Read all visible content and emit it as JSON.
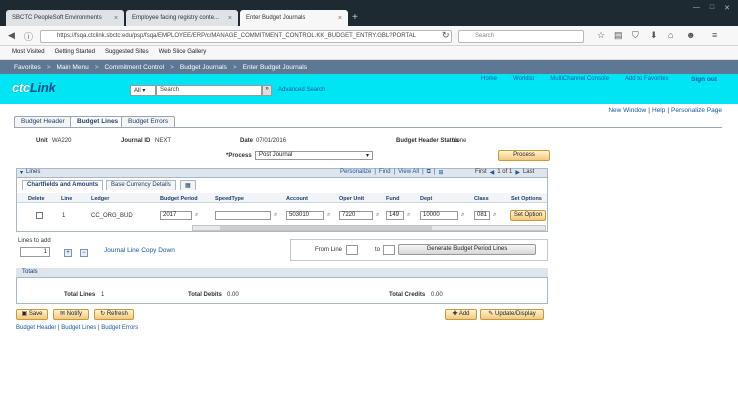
{
  "browser": {
    "tabs": [
      {
        "label": "SBCTC PeopleSoft Environments",
        "active": false
      },
      {
        "label": "Employee facing registry conte...",
        "active": false
      },
      {
        "label": "Enter Budget Journals",
        "active": true
      }
    ],
    "url": "https://fsqa.ctclink.sbctc.edu/psp/fsqa/EMPLOYEE/ERP/c/MANAGE_COMMITMENT_CONTROL.KK_BUDGET_ENTRY.GBL?PORTAL",
    "search_placeholder": "Search",
    "bookmarks": [
      "Most Visited",
      "Getting Started",
      "Suggested Sites",
      "Web Slice Gallery"
    ]
  },
  "ps_nav": {
    "items": [
      "Favorites",
      "Main Menu",
      "Commitment Control",
      "Budget Journals",
      "Enter Budget Journals"
    ],
    "separator": ">"
  },
  "banner": {
    "logo_ctc": "ctc",
    "logo_link": "Link",
    "links": [
      "Home",
      "Worklist",
      "MultiChannel Console",
      "Add to Favorites"
    ],
    "sign_out": "Sign out",
    "search_scope": "All",
    "search_value": "Search",
    "advanced_search": "Advanced Search"
  },
  "top_links": [
    "New Window",
    "Help",
    "Personalize Page"
  ],
  "page_tabs": [
    {
      "label": "Budget Header",
      "active": false
    },
    {
      "label": "Budget Lines",
      "active": true
    },
    {
      "label": "Budget Errors",
      "active": false
    }
  ],
  "header": {
    "unit_label": "Unit",
    "unit_value": "WA220",
    "journal_id_label": "Journal ID",
    "journal_id_value": "NEXT",
    "date_label": "Date",
    "date_value": "07/01/2016",
    "status_label": "Budget Header Status",
    "status_value": "None",
    "process_label": "*Process",
    "process_value": "Post Journal",
    "process_button": "Process"
  },
  "lines": {
    "title": "Lines",
    "nav": {
      "personalize": "Personalize",
      "find": "Find",
      "view_all": "View All",
      "first": "First",
      "range": "1 of 1",
      "last": "Last"
    },
    "subtabs": [
      {
        "label": "Chartfields and Amounts",
        "active": true
      },
      {
        "label": "Base Currency Details",
        "active": false
      }
    ],
    "columns": [
      "Delete",
      "Line",
      "Ledger",
      "Budget Period",
      "SpeedType",
      "Account",
      "Oper Unit",
      "Fund",
      "Dept",
      "Class",
      "Set Options"
    ],
    "rows": [
      {
        "line": "1",
        "ledger": "CC_ORG_BUD",
        "budget_period": "2017",
        "speedtype": "",
        "account": "503010",
        "oper_unit": "7220",
        "fund": "149",
        "dept": "10000",
        "class": "081",
        "set_options": "Set Option"
      }
    ]
  },
  "lines_to_add": {
    "label": "Lines to add",
    "value": "1",
    "copy_down": "Journal Line Copy Down",
    "from_line_label": "From Line",
    "to_label": "to",
    "generate_button": "Generate Budget Period Lines"
  },
  "totals": {
    "title": "Totals",
    "total_lines_label": "Total Lines",
    "total_lines_value": "1",
    "total_debits_label": "Total Debits",
    "total_debits_value": "0.00",
    "total_credits_label": "Total Credits",
    "total_credits_value": "0.00"
  },
  "footer": {
    "save": "Save",
    "notify": "Notify",
    "refresh": "Refresh",
    "add": "Add",
    "update_display": "Update/Display",
    "links": [
      "Budget Header",
      "Budget Lines",
      "Budget Errors"
    ]
  },
  "colors": {
    "banner": "#00e5f3",
    "ps_nav": "#5d7895",
    "link": "#1559a8"
  }
}
